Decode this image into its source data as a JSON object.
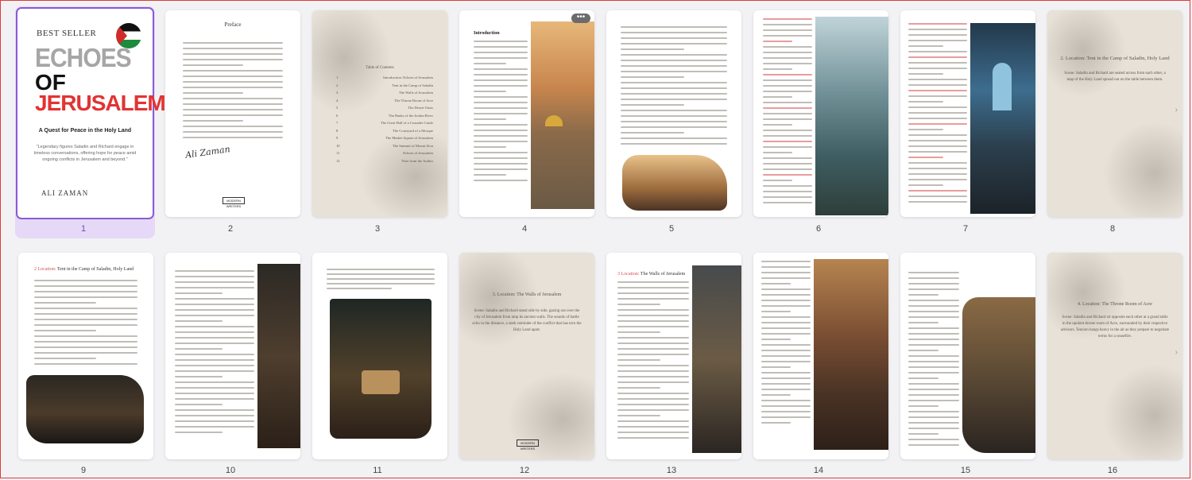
{
  "cover": {
    "badge": "BEST SELLER",
    "title_line1": "ECHOES",
    "title_line2": "OF",
    "title_line3": "JERUSALEM",
    "subtitle": "A Quest for Peace in the Holy Land",
    "quote": "\"Legendary figures Saladin and Richard engage in timeless conversations, offering hope for peace amid ongoing conflicts in Jerusalem and beyond.\"",
    "author": "ALI ZAMAN"
  },
  "page2": {
    "heading": "Preface",
    "signature": "Ali Zaman"
  },
  "page3": {
    "heading": "Table of Contents",
    "items": [
      "Introduction: Echoes of Jerusalem",
      "Tent in the Camp of Saladin",
      "The Walls of Jerusalem",
      "The Throne Room of Acre",
      "The Desert Oasis",
      "The Banks of the Jordan River",
      "The Great Hall of a Crusader Castle",
      "The Courtyard of a Mosque",
      "The Market Square of Jerusalem",
      "The Summit of Mount Zion",
      "Echoes of Jerusalem",
      "Note from the Author"
    ],
    "numbers": [
      "1",
      "2",
      "3",
      "4",
      "5",
      "6",
      "7",
      "8",
      "9",
      "10",
      "11",
      "12"
    ]
  },
  "page4": {
    "heading": "Introduction"
  },
  "page8": {
    "heading": "2. Location: Tent in the Camp of Saladin, Holy Land",
    "body": "Scene: Saladin and Richard are seated across from each other, a map of the Holy Land spread out on the table between them."
  },
  "page9": {
    "heading_prefix": "2 Location:",
    "heading_rest": "Tent in the Camp of Saladin, Holy Land"
  },
  "page12": {
    "heading": "3. Location: The Walls of Jerusalem",
    "body": "Scene: Saladin and Richard stand side by side, gazing out over the city of Jerusalem from atop its ancient walls. The sounds of battle echo in the distance, a stark reminder of the conflict that has torn the Holy Land apart."
  },
  "page13": {
    "heading_prefix": "3 Location:",
    "heading_rest": "The Walls of Jerusalem"
  },
  "page16": {
    "heading": "4. Location: The Throne Room of Acre",
    "body": "Scene: Saladin and Richard sit opposite each other at a grand table in the opulent throne room of Acre, surrounded by their respective advisors. Tension hangs heavy in the air as they prepare to negotiate terms for a ceasefire."
  },
  "page_numbers": [
    "1",
    "2",
    "3",
    "4",
    "5",
    "6",
    "7",
    "8",
    "9",
    "10",
    "11",
    "12",
    "13",
    "14",
    "15",
    "16"
  ],
  "more_menu": "•••",
  "stamp_label": "MODERN WRITERS",
  "colors": {
    "selection": "#8a5ad9",
    "selection_bg": "#e6d9f7",
    "accent_red": "#d64d4d",
    "cream": "#e7e1d7"
  }
}
